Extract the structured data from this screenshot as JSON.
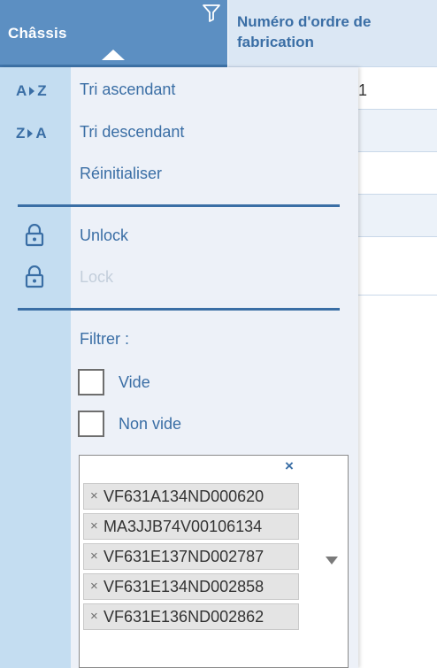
{
  "grid": {
    "column_chassis": {
      "label": "Châssis",
      "filter_icon": "filter-icon",
      "sort_icon": "sort-ascending-icon"
    },
    "column_numero": {
      "label": "Numéro d'ordre de fabrication"
    },
    "peek_value": "1"
  },
  "menu": {
    "sort_asc": {
      "icon": "A Z",
      "label": "Tri ascendant"
    },
    "sort_desc": {
      "icon": "Z A",
      "label": "Tri descendant"
    },
    "reset": {
      "label": "Réinitialiser"
    },
    "unlock": {
      "label": "Unlock",
      "icon": "unlock-icon"
    },
    "lock": {
      "label": "Lock",
      "icon": "lock-icon",
      "disabled": true
    }
  },
  "filter": {
    "title": "Filtrer :",
    "empty_label": "Vide",
    "not_empty_label": "Non vide",
    "clear_all_glyph": "×",
    "tags": [
      "VF631A134ND000620",
      "MA3JJB74V00106134",
      "VF631E137ND002787",
      "VF631E134ND002858",
      "VF631E136ND002862"
    ],
    "tag_remove_glyph": "×"
  },
  "colors": {
    "accent": "#3a6ea5",
    "header_bg": "#5c8fc2",
    "gutter_bg": "#c4ddf1",
    "menu_bg": "#edf1f8",
    "disabled_text": "#c3cedb"
  }
}
